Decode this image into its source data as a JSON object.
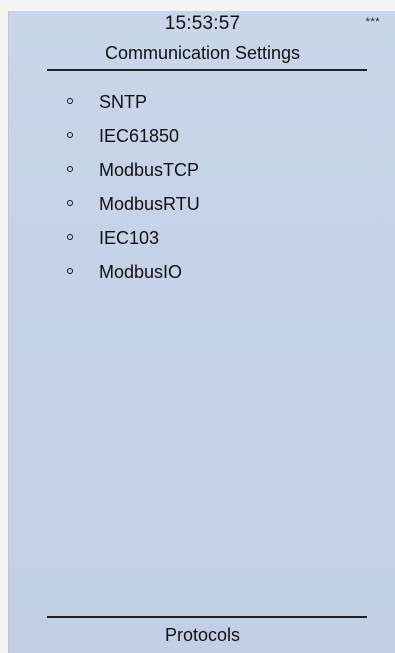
{
  "header": {
    "time": "15:53:57",
    "status_indicator": "***",
    "title": "Communication Settings"
  },
  "menu": {
    "items": [
      {
        "label": "SNTP"
      },
      {
        "label": "IEC61850"
      },
      {
        "label": "ModbusTCP"
      },
      {
        "label": "ModbusRTU"
      },
      {
        "label": "IEC103"
      },
      {
        "label": "ModbusIO"
      }
    ]
  },
  "footer": {
    "label": "Protocols"
  },
  "colors": {
    "panel_background": "#c5d2e7",
    "text": "#111111"
  }
}
